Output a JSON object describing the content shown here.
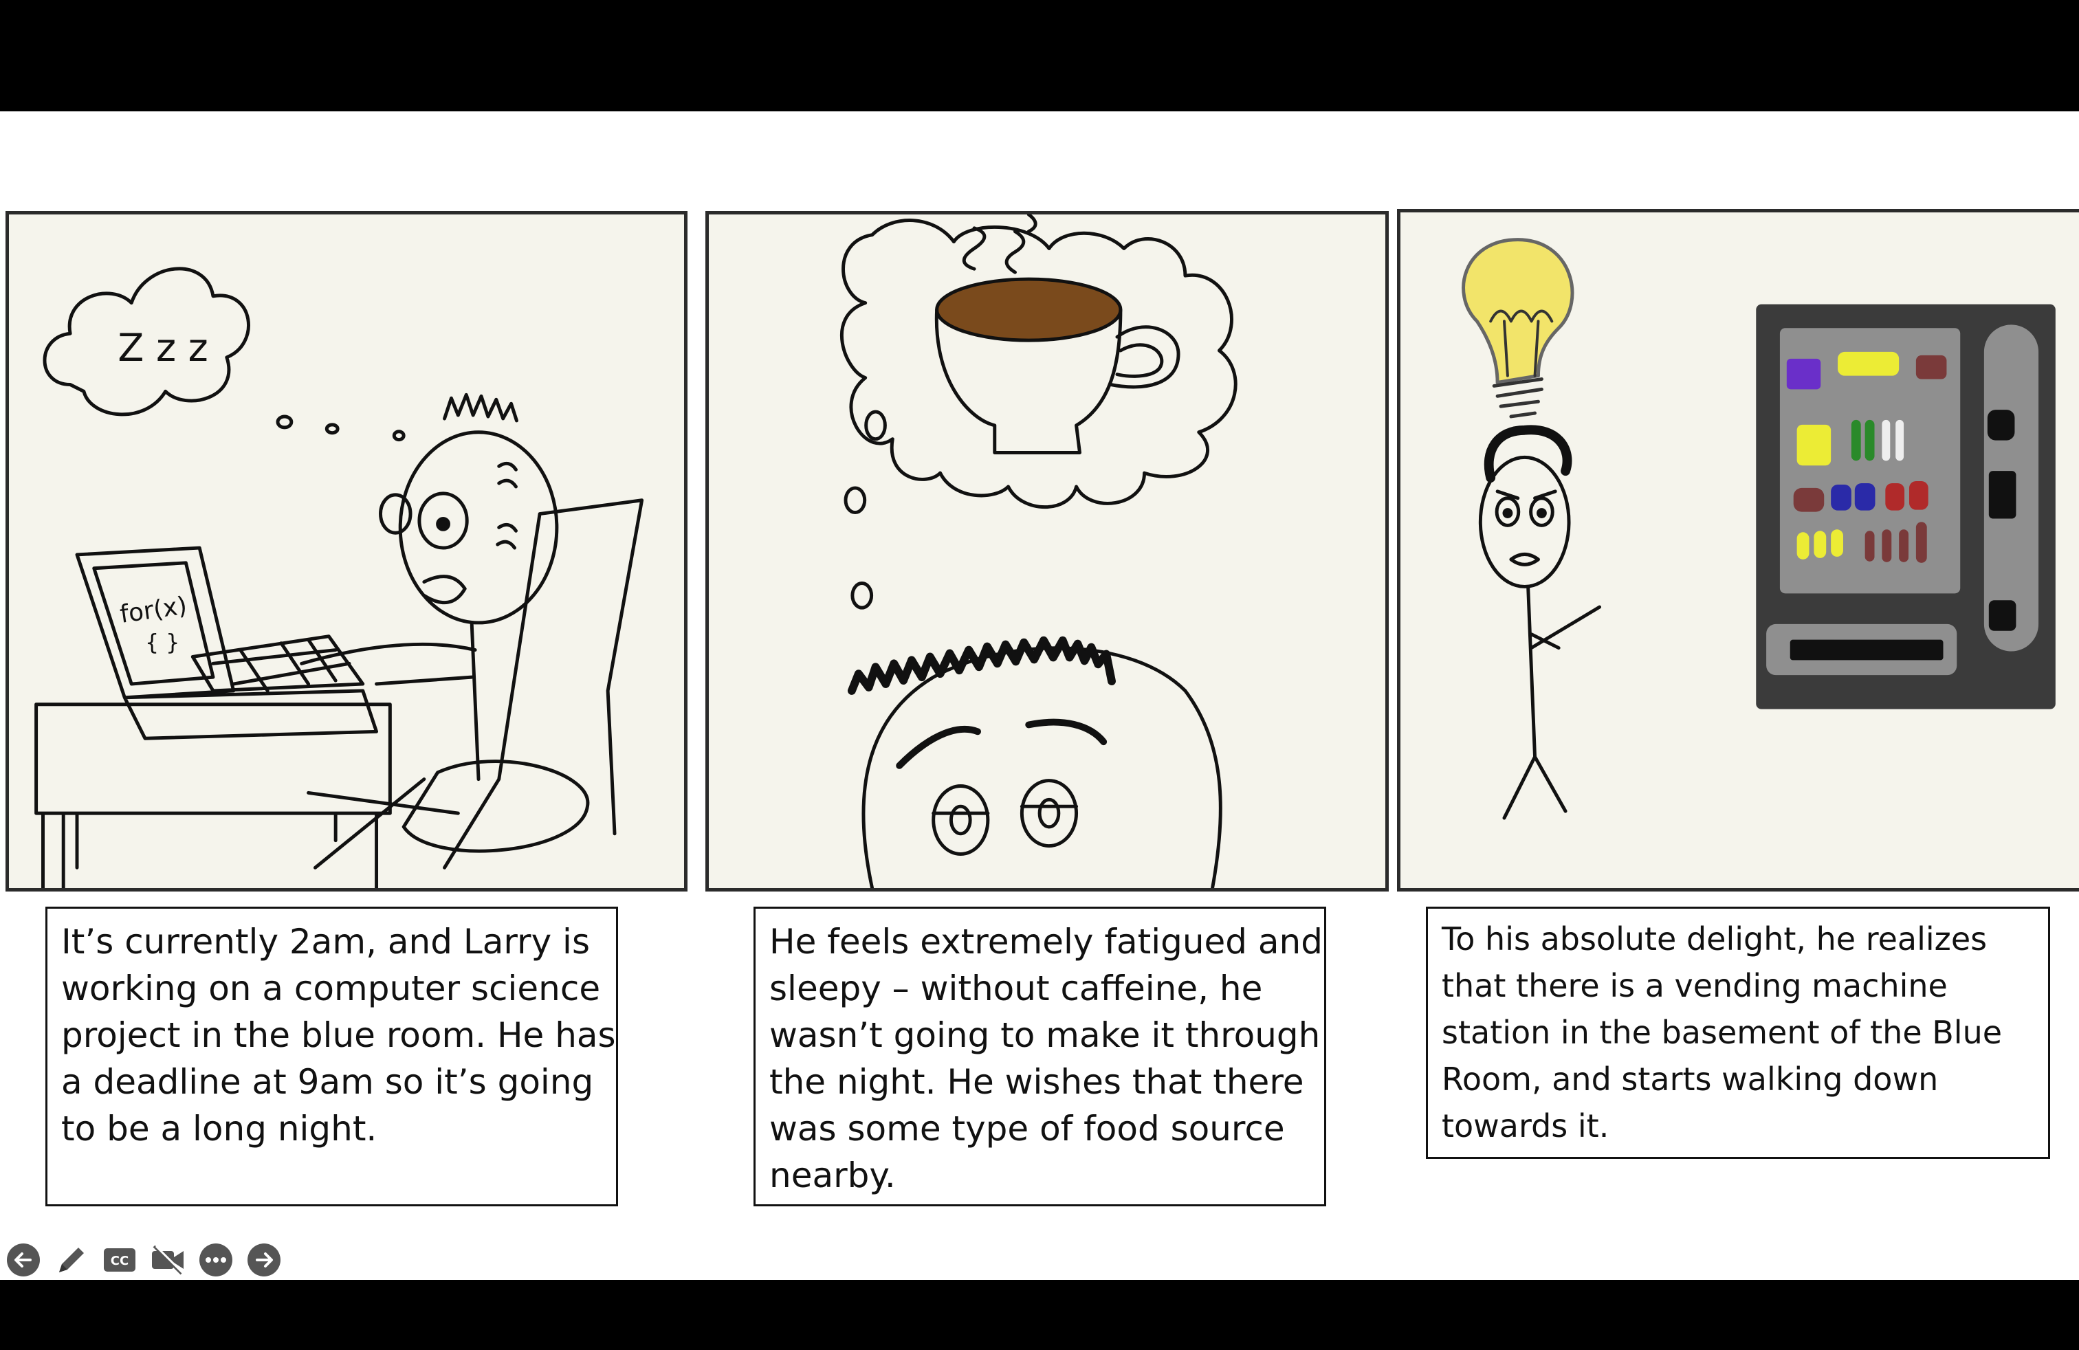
{
  "captions": {
    "panel1": "It’s currently 2am, and Larry is working on a computer science project in the blue room. He has a deadline at 9am so it’s going to be a long night.",
    "panel2": "He feels extremely fatigued and sleepy – without caffeine, he wasn’t going to make it through the night. He wishes that there was some type of food source nearby.",
    "panel3": "To his absolute delight, he realizes that there is a vending machine station in the basement of the Blue Room, and starts walking down towards it."
  },
  "drawing_text": {
    "snore": "Z z z",
    "laptop_code": "for(x)",
    "laptop_braces": "{ }"
  },
  "toolbar": {
    "icons": [
      "previous-slide-icon",
      "pen-icon",
      "closed-captions-icon",
      "video-off-icon",
      "more-options-icon",
      "next-slide-icon"
    ],
    "cc_label": "CC"
  },
  "colors": {
    "panel_bg": "#f5f4ec",
    "coffee": "#7a4a1c",
    "bulb": "#f2e46a",
    "vending_body": "#3b3b3b",
    "vending_window": "#8f8f8f"
  }
}
